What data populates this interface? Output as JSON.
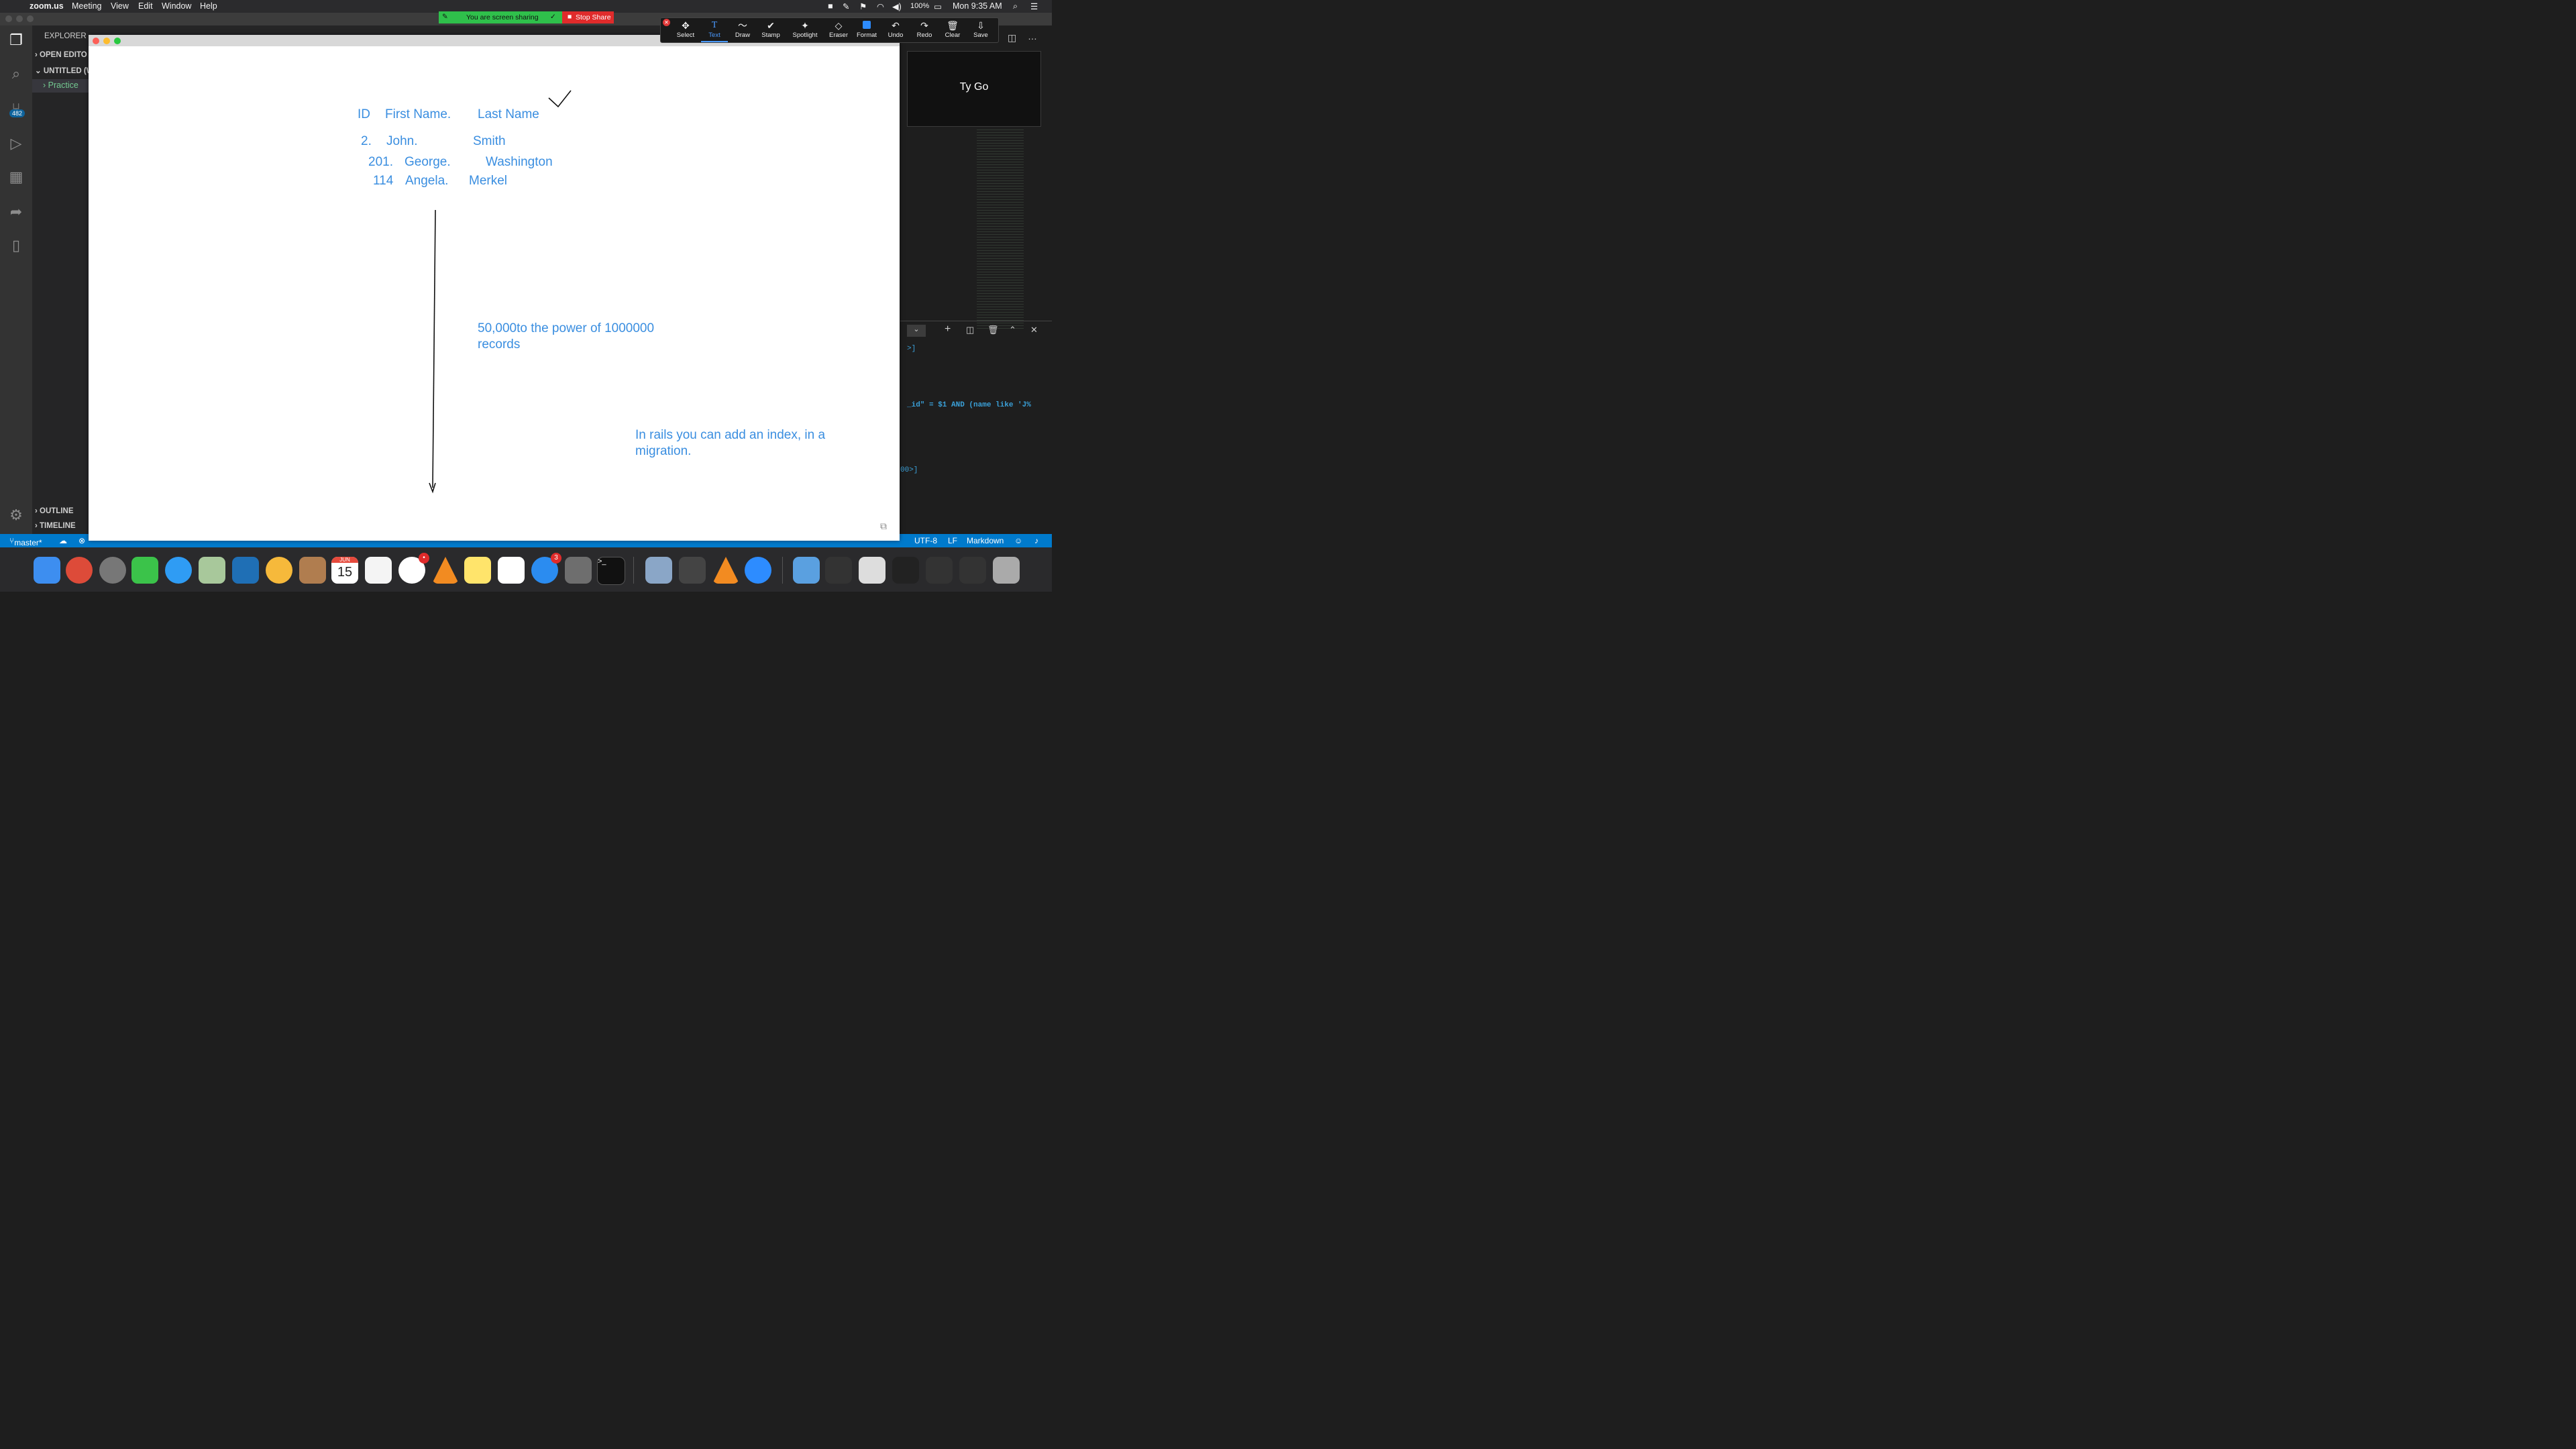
{
  "menubar": {
    "app": "zoom.us",
    "items": [
      "Meeting",
      "View",
      "Edit",
      "Window",
      "Help"
    ],
    "battery": "100%",
    "clock": "Mon 9:35 AM"
  },
  "share_banner": {
    "status": "You are screen sharing",
    "stop": "Stop Share"
  },
  "toolbar": {
    "tools": [
      "Select",
      "Text",
      "Draw",
      "Stamp",
      "Spotlight",
      "Eraser",
      "Format",
      "Undo",
      "Redo",
      "Clear",
      "Save"
    ],
    "active": "Text"
  },
  "vscode": {
    "explorer_title": "EXPLORER",
    "open_editors": "OPEN EDITO",
    "untitled": "UNTITLED (W",
    "practice": "Practice",
    "source_control_badge": "482",
    "outline": "OUTLINE",
    "timeline": "TIMELINE",
    "branch": "master*",
    "encoding": "UTF-8",
    "eol": "LF",
    "language": "Markdown",
    "terminal_lines": [
      ">]",
      "_id\" = $1 AND (name like 'J%",
      "00>]"
    ]
  },
  "video": {
    "participant": "Ty Go"
  },
  "whiteboard": {
    "table_headers": [
      "ID",
      "First Name.",
      "Last Name"
    ],
    "rows": [
      {
        "id": "2.",
        "first": "John.",
        "last": "Smith"
      },
      {
        "id": "201.",
        "first": "George.",
        "last": "Washington"
      },
      {
        "id": "114",
        "first": "Angela.",
        "last": "Merkel"
      }
    ],
    "note1": [
      "50,000to the power of 1000000",
      "records"
    ],
    "note2": [
      "In rails you can add an index, in a",
      "migration."
    ]
  },
  "dock": {
    "calendar_month": "JUN",
    "calendar_day": "15",
    "slack_badge": "•",
    "appstore_badge": "3"
  },
  "colors": {
    "ink_blue": "#3a8ee0",
    "status_blue": "#007acc",
    "share_green": "#2fc04b",
    "stop_red": "#e02b2b"
  }
}
